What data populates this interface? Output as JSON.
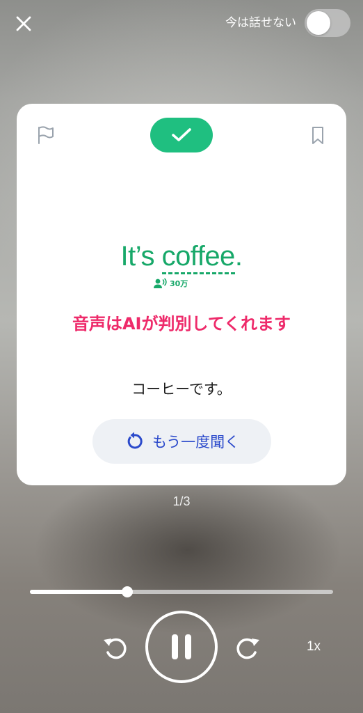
{
  "header": {
    "close_icon": "close-icon",
    "no_speak_label": "今は話せない",
    "no_speak_toggle_on": false
  },
  "card": {
    "flag_icon": "flag-icon",
    "bookmark_icon": "bookmark-icon",
    "check_icon": "check-icon",
    "check_color": "#1fbf80",
    "sentence_plain": "It’s ",
    "sentence_highlight": "coffee",
    "sentence_end": ".",
    "sentence_color": "#17a869",
    "speakers_icon": "people-voice-icon",
    "speakers_count": "30万",
    "ai_caption": "音声はAIが判別してくれます",
    "ai_caption_color": "#ee2a6a",
    "translation": "コーヒーです。",
    "replay_icon": "replay-icon",
    "replay_label": "もう一度聞く",
    "replay_color": "#2b4acb"
  },
  "page_counter": "1/3",
  "player": {
    "progress": 0.32,
    "rewind_icon": "rewind-icon",
    "pause_icon": "pause-icon",
    "forward_icon": "forward-icon",
    "speed": "1x"
  }
}
